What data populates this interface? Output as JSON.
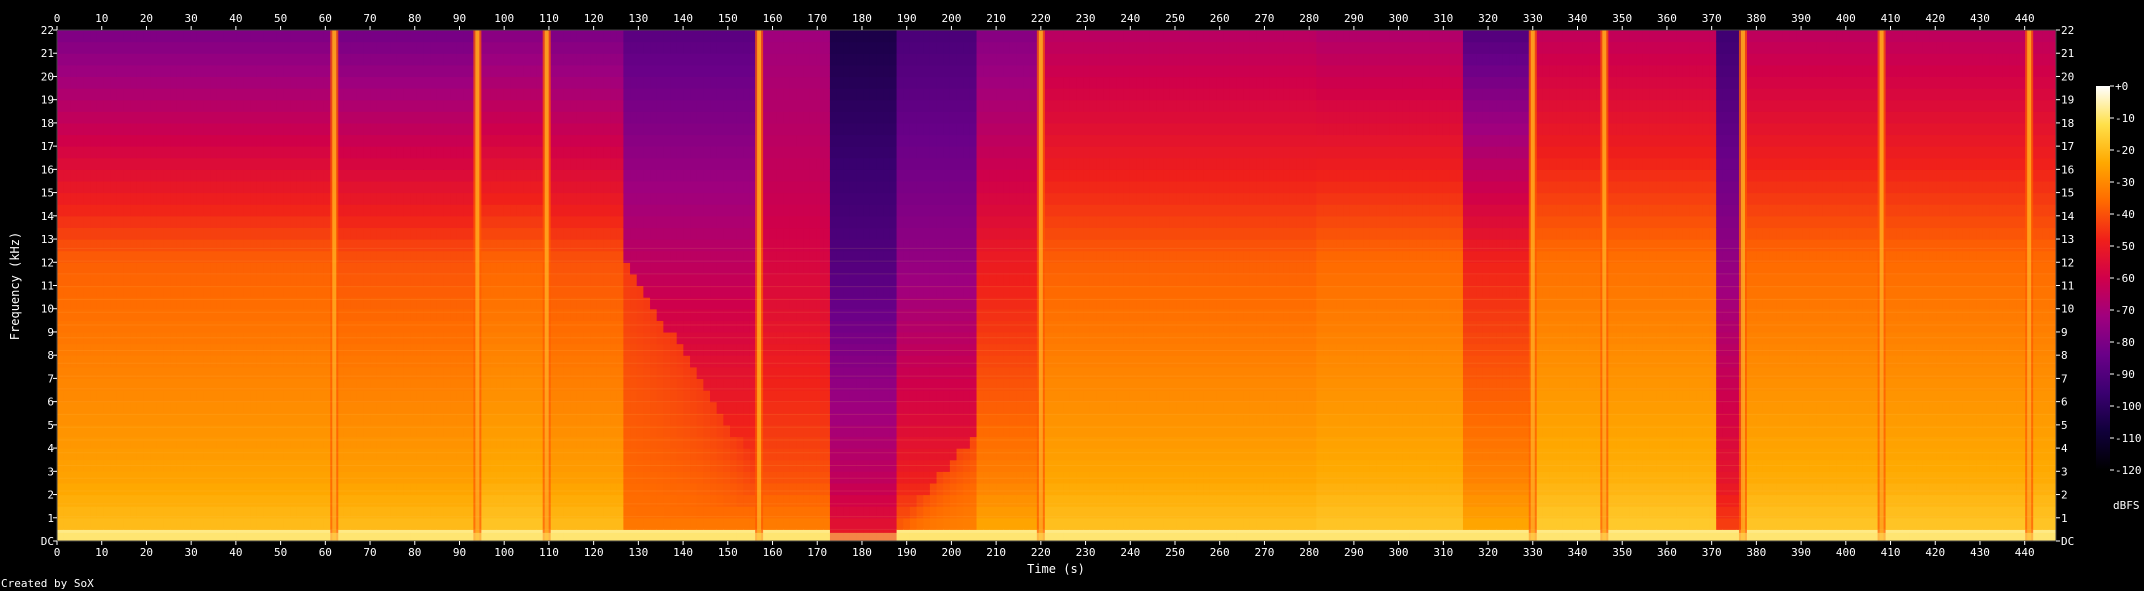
{
  "chart_data": {
    "type": "heatmap",
    "subtype": "spectrogram",
    "title": "",
    "xlabel": "Time (s)",
    "ylabel": "Frequency (kHz)",
    "xlim": [
      0,
      447
    ],
    "ylim": [
      0,
      22
    ],
    "x_ticks": [
      0,
      10,
      20,
      30,
      40,
      50,
      60,
      70,
      80,
      90,
      100,
      110,
      120,
      130,
      140,
      150,
      160,
      170,
      180,
      190,
      200,
      210,
      220,
      230,
      240,
      250,
      260,
      270,
      280,
      290,
      300,
      310,
      320,
      330,
      340,
      350,
      360,
      370,
      380,
      390,
      400,
      410,
      420,
      430,
      440
    ],
    "y_ticks": [
      {
        "value": 0,
        "label": "DC"
      },
      {
        "value": 1,
        "label": "1"
      },
      {
        "value": 2,
        "label": "2"
      },
      {
        "value": 3,
        "label": "3"
      },
      {
        "value": 4,
        "label": "4"
      },
      {
        "value": 5,
        "label": "5"
      },
      {
        "value": 6,
        "label": "6"
      },
      {
        "value": 7,
        "label": "7"
      },
      {
        "value": 8,
        "label": "8"
      },
      {
        "value": 9,
        "label": "9"
      },
      {
        "value": 10,
        "label": "10"
      },
      {
        "value": 11,
        "label": "11"
      },
      {
        "value": 12,
        "label": "12"
      },
      {
        "value": 13,
        "label": "13"
      },
      {
        "value": 14,
        "label": "14"
      },
      {
        "value": 15,
        "label": "15"
      },
      {
        "value": 16,
        "label": "16"
      },
      {
        "value": 17,
        "label": "17"
      },
      {
        "value": 18,
        "label": "18"
      },
      {
        "value": 19,
        "label": "19"
      },
      {
        "value": 20,
        "label": "20"
      },
      {
        "value": 21,
        "label": "21"
      },
      {
        "value": 22,
        "label": "22"
      }
    ],
    "colorbar": {
      "label": "dBFS",
      "ticks": [
        "+0",
        "-10",
        "-20",
        "-30",
        "-40",
        "-50",
        "-60",
        "-70",
        "-80",
        "-90",
        "-100",
        "-110",
        "-120"
      ],
      "range": [
        -120,
        0
      ],
      "colormap": [
        "#000000",
        "#10003a",
        "#3a0070",
        "#6a0088",
        "#a0007e",
        "#d0004a",
        "#f0201a",
        "#ff6a00",
        "#ffa800",
        "#ffe04a",
        "#ffffff"
      ]
    },
    "loud_bursts_s": [
      62,
      94,
      109.5,
      157,
      220,
      330,
      346,
      377,
      408,
      441
    ],
    "quiet_regions_s": [
      [
        173,
        187
      ],
      [
        371,
        374
      ]
    ],
    "segments": [
      {
        "t0": 0,
        "t1": 62,
        "db_low": -18,
        "db_mid": -38,
        "db_high": -80
      },
      {
        "t0": 62,
        "t1": 94,
        "db_low": -18,
        "db_mid": -40,
        "db_high": -82
      },
      {
        "t0": 94,
        "t1": 110,
        "db_low": -16,
        "db_mid": -37,
        "db_high": -78
      },
      {
        "t0": 110,
        "t1": 127,
        "db_low": -18,
        "db_mid": -40,
        "db_high": -80
      },
      {
        "t0": 127,
        "t1": 157,
        "db_low": -30,
        "db_mid": -65,
        "db_high": -88
      },
      {
        "t0": 157,
        "t1": 173,
        "db_low": -30,
        "db_mid": -58,
        "db_high": -72
      },
      {
        "t0": 173,
        "t1": 187,
        "db_low": -50,
        "db_mid": -90,
        "db_high": -105
      },
      {
        "t0": 187,
        "t1": 205,
        "db_low": -35,
        "db_mid": -75,
        "db_high": -92
      },
      {
        "t0": 205,
        "t1": 220,
        "db_low": -22,
        "db_mid": -50,
        "db_high": -78
      },
      {
        "t0": 220,
        "t1": 282,
        "db_low": -17,
        "db_mid": -38,
        "db_high": -66
      },
      {
        "t0": 282,
        "t1": 315,
        "db_low": -16,
        "db_mid": -36,
        "db_high": -68
      },
      {
        "t0": 315,
        "t1": 330,
        "db_low": -22,
        "db_mid": -48,
        "db_high": -90
      },
      {
        "t0": 330,
        "t1": 371,
        "db_low": -15,
        "db_mid": -35,
        "db_high": -64
      },
      {
        "t0": 371,
        "t1": 377,
        "db_low": -40,
        "db_mid": -75,
        "db_high": -95
      },
      {
        "t0": 377,
        "t1": 447,
        "db_low": -16,
        "db_mid": -36,
        "db_high": -65
      }
    ]
  },
  "footer": {
    "credit": "Created by SoX"
  }
}
